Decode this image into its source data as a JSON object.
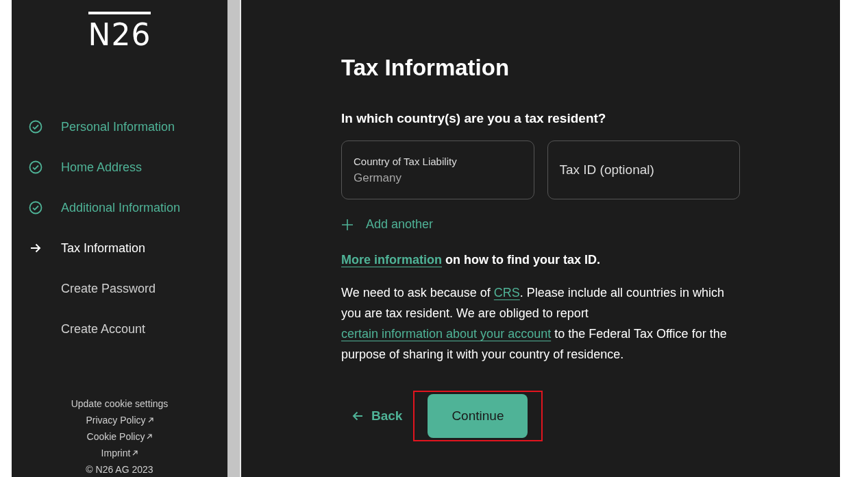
{
  "sidebar": {
    "logo": "N26",
    "steps": [
      {
        "label": "Personal Information",
        "completed": true,
        "selected": false
      },
      {
        "label": "Home Address",
        "completed": true,
        "selected": false
      },
      {
        "label": "Additional Information",
        "completed": true,
        "selected": false
      },
      {
        "label": "Tax Information",
        "completed": false,
        "selected": true
      },
      {
        "label": "Create Password",
        "completed": false,
        "selected": false
      },
      {
        "label": "Create Account",
        "completed": false,
        "selected": false
      }
    ],
    "footer_links": [
      {
        "label": "Update cookie settings",
        "external": false
      },
      {
        "label": "Privacy Policy",
        "external": true
      },
      {
        "label": "Cookie Policy",
        "external": true
      },
      {
        "label": "Imprint",
        "external": true
      }
    ],
    "copyright": "© N26 AG 2023"
  },
  "main": {
    "title": "Tax Information",
    "question": "In which country(s) are you a tax resident?",
    "fields": [
      {
        "label": "Country of Tax Liability",
        "value": "Germany"
      },
      {
        "placeholder": "Tax ID (optional)"
      }
    ],
    "add_another": "Add another",
    "more_info": [
      {
        "text": "More information",
        "link": true
      },
      {
        "text": " on how to find your tax ID.",
        "link": false
      }
    ],
    "explanation": [
      {
        "text": "We need to ask because of ",
        "link": false
      },
      {
        "text": "CRS",
        "link": true
      },
      {
        "text": ". Please include all countries in which you are tax resident. We are obliged to report ",
        "link": false
      },
      {
        "text": "certain information about your account",
        "link": true
      },
      {
        "text": " to the Federal Tax Office for the purpose of sharing it with your country of residence.",
        "link": false
      }
    ],
    "back": "Back",
    "continue": "Continue",
    "continue_highlighted": true
  }
}
